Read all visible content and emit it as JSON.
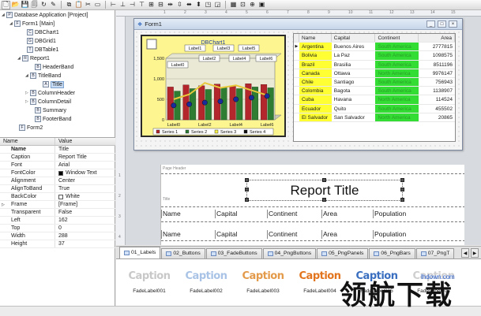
{
  "toolbar": {
    "buttons": [
      "new-icon",
      "open-icon",
      "save-icon",
      "save-all-icon",
      "refresh-icon",
      "run-icon"
    ]
  },
  "tree": {
    "nodes": [
      {
        "label": "Database Application [Project]",
        "expander": "◢",
        "icon": "P"
      },
      {
        "label": "Form1 [Main]",
        "expander": "◢",
        "icon": "F"
      },
      {
        "label": "DBChart1",
        "expander": "",
        "icon": "C"
      },
      {
        "label": "DBGrid1",
        "expander": "",
        "icon": "G"
      },
      {
        "label": "DBTable1",
        "expander": "",
        "icon": "T"
      },
      {
        "label": "Report1",
        "expander": "◢",
        "icon": "R"
      },
      {
        "label": "HeaderBand",
        "expander": "",
        "icon": "B"
      },
      {
        "label": "TitleBand",
        "expander": "◢",
        "icon": "B"
      },
      {
        "label": "Title",
        "expander": "",
        "icon": "A"
      },
      {
        "label": "ColumnHeader",
        "expander": "▷",
        "icon": "B"
      },
      {
        "label": "ColumnDetail",
        "expander": "▷",
        "icon": "B"
      },
      {
        "label": "Summary",
        "expander": "",
        "icon": "B"
      },
      {
        "label": "FooterBand",
        "expander": "",
        "icon": "B"
      },
      {
        "label": "Form2",
        "expander": "",
        "icon": "F"
      }
    ]
  },
  "properties": {
    "header_name": "Name",
    "header_value": "Value",
    "rows": [
      {
        "name": "Name",
        "value": "Title",
        "bold": true,
        "exp": "",
        "color": ""
      },
      {
        "name": "Caption",
        "value": "Report Title",
        "bold": false,
        "exp": "",
        "color": ""
      },
      {
        "name": "Font",
        "value": "Arial",
        "bold": false,
        "exp": "",
        "color": ""
      },
      {
        "name": "FontColor",
        "value": "Window Text",
        "bold": false,
        "exp": "",
        "color": "#000000"
      },
      {
        "name": "Alignment",
        "value": "Center",
        "bold": false,
        "exp": "",
        "color": ""
      },
      {
        "name": "AlignToBand",
        "value": "True",
        "bold": false,
        "exp": "",
        "color": ""
      },
      {
        "name": "BackColor",
        "value": "White",
        "bold": false,
        "exp": "",
        "color": "#ffffff"
      },
      {
        "name": "Frame",
        "value": "[Frame]",
        "bold": false,
        "exp": "▷",
        "color": ""
      },
      {
        "name": "Transparent",
        "value": "False",
        "bold": false,
        "exp": "",
        "color": ""
      },
      {
        "name": "Left",
        "value": "162",
        "bold": false,
        "exp": "",
        "color": ""
      },
      {
        "name": "Top",
        "value": "0",
        "bold": false,
        "exp": "",
        "color": ""
      },
      {
        "name": "Width",
        "value": "288",
        "bold": false,
        "exp": "",
        "color": ""
      },
      {
        "name": "Height",
        "value": "37",
        "bold": false,
        "exp": "",
        "color": ""
      }
    ]
  },
  "form": {
    "title": "Form1",
    "controls": [
      "_",
      "□",
      "×"
    ]
  },
  "chart": {
    "title": "DBChart1",
    "callouts": [
      "Label1",
      "Label3",
      "Label5",
      "Label0",
      "Label2",
      "Label4",
      "Label6"
    ],
    "yticks": [
      "1,500",
      "1,000",
      "500",
      "0"
    ],
    "xticks": [
      "Label0",
      "Label2",
      "Label4",
      "Label6"
    ],
    "legend": [
      "Series 1",
      "Series 2",
      "Series 3",
      "Series 4"
    ],
    "colors": {
      "s1": "#b3262b",
      "s2": "#2e7d32",
      "s3": "#f5ee46",
      "s4": "#101010",
      "line": "#e8c93c",
      "dot": "#1a2c9a"
    }
  },
  "chart_data": {
    "type": "bar",
    "title": "DBChart1",
    "categories": [
      "Label0",
      "Label1",
      "Label2",
      "Label3",
      "Label4",
      "Label5",
      "Label6"
    ],
    "series": [
      {
        "name": "Series 1",
        "values": [
          800,
          850,
          830,
          870,
          820,
          880,
          860
        ]
      },
      {
        "name": "Series 2",
        "values": [
          700,
          760,
          740,
          790,
          760,
          800,
          780
        ]
      },
      {
        "name": "Series 3",
        "values": [
          500,
          620,
          900,
          780,
          840,
          720,
          600
        ]
      },
      {
        "name": "Series 4",
        "values": [
          350,
          380,
          420,
          450,
          500,
          540,
          580
        ]
      }
    ],
    "ylim": [
      0,
      1500
    ],
    "legend": "bottom"
  },
  "grid": {
    "headers": [
      "Name",
      "Capital",
      "Continent",
      "Area"
    ],
    "rows": [
      [
        "Argentina",
        "Buenos Aires",
        "South America",
        "2777815"
      ],
      [
        "Bolivia",
        "La Paz",
        "South America",
        "1098575"
      ],
      [
        "Brazil",
        "Brasilia",
        "South America",
        "8511196"
      ],
      [
        "Canada",
        "Ottawa",
        "North America",
        "9976147"
      ],
      [
        "Chile",
        "Santiago",
        "South America",
        "756943"
      ],
      [
        "Colombia",
        "Bagota",
        "South America",
        "1138907"
      ],
      [
        "Cuba",
        "Havana",
        "North America",
        "114524"
      ],
      [
        "Ecuador",
        "Quito",
        "South America",
        "455502"
      ],
      [
        "El Salvador",
        "San Salvador",
        "North America",
        "20865"
      ]
    ]
  },
  "rulers": {
    "top": [
      "1",
      "2",
      "3",
      "4",
      "5",
      "6",
      "7",
      "8",
      "9",
      "10",
      "11",
      "12",
      "13",
      "14",
      "15"
    ],
    "left": [
      "1",
      "2",
      "3",
      "4"
    ]
  },
  "report": {
    "page_header_label": "Page Header",
    "title_band_label": "Title",
    "title": "Report Title",
    "columns": [
      "Name",
      "Capital",
      "Continent",
      "Area",
      "Population"
    ]
  },
  "tabs": [
    {
      "label": "01_Labels",
      "active": true
    },
    {
      "label": "02_Buttons",
      "active": false
    },
    {
      "label": "03_FadeButtons",
      "active": false
    },
    {
      "label": "04_PngButtons",
      "active": false
    },
    {
      "label": "05_PngPanels",
      "active": false
    },
    {
      "label": "06_PngBars",
      "active": false
    },
    {
      "label": "07_PngT",
      "active": false
    }
  ],
  "palette": [
    {
      "caption": "Caption",
      "name": "FadeLabel001",
      "color": "#c8c8c8"
    },
    {
      "caption": "Caption",
      "name": "FadeLabel002",
      "color": "#a9c3e6"
    },
    {
      "caption": "Caption",
      "name": "FadeLabel003",
      "color": "#e39a4a"
    },
    {
      "caption": "Caption",
      "name": "FadeLabel004",
      "color": "#e2741e"
    },
    {
      "caption": "Caption",
      "name": "FadeLabel005",
      "color": "#3a6fc0"
    },
    {
      "caption": "Caption",
      "name": "FadeLabel006",
      "color": "#cfcfcf"
    }
  ],
  "watermark": {
    "text": "领航下载",
    "url": "lhdown.com"
  }
}
